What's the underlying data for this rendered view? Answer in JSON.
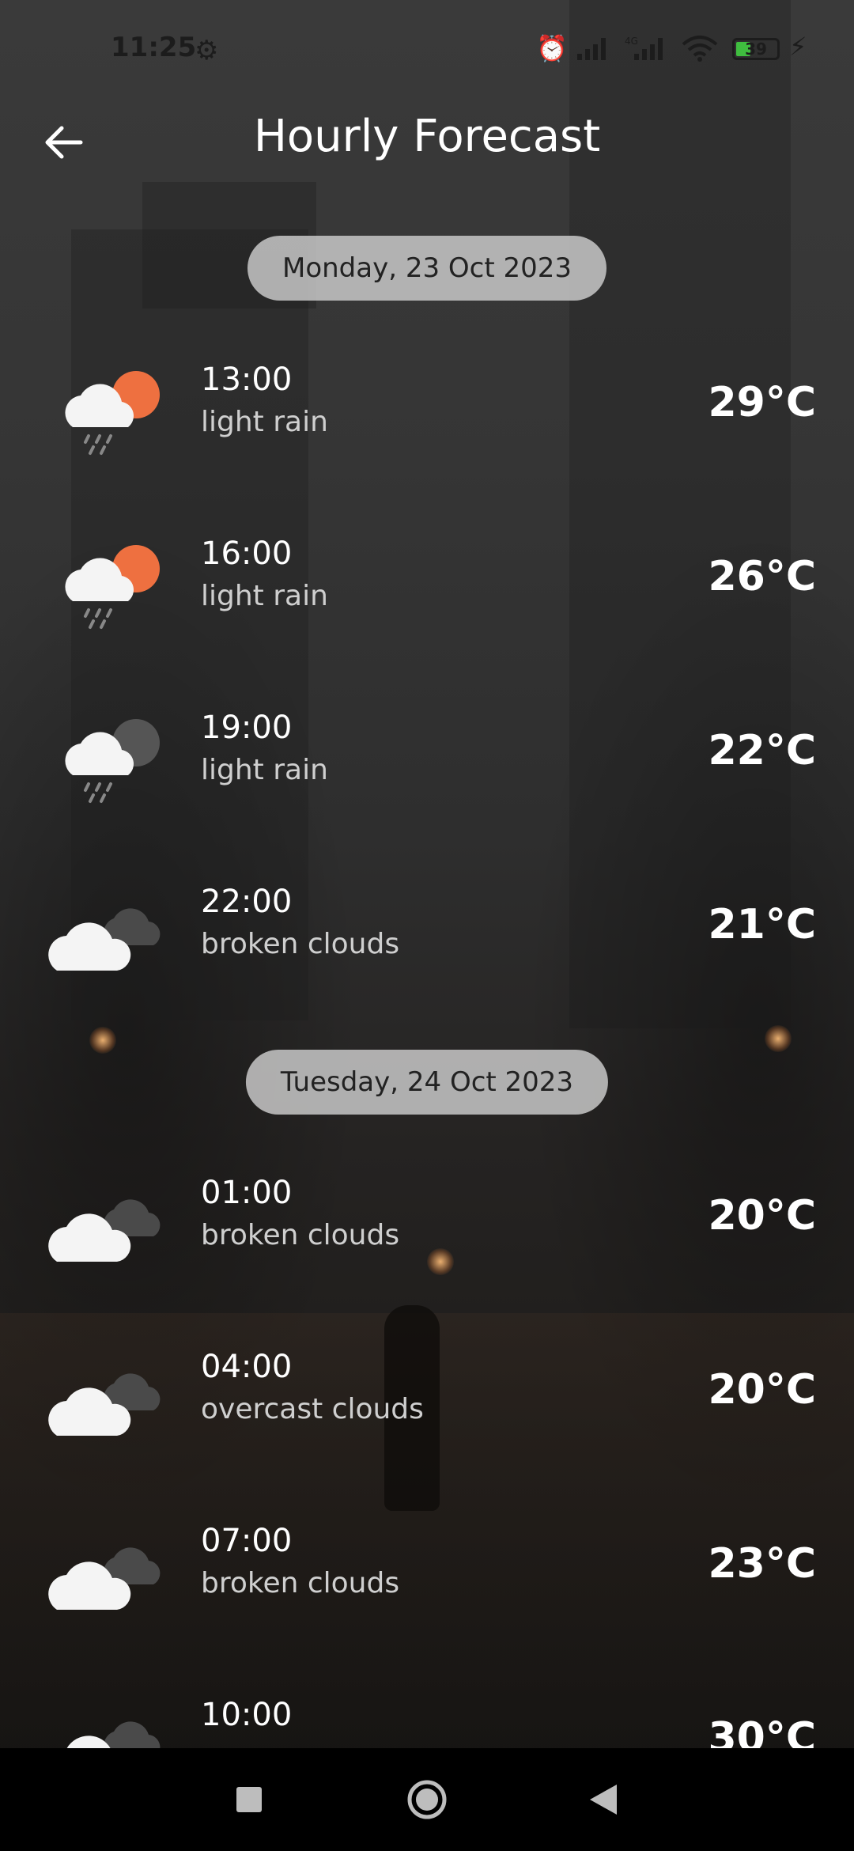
{
  "status_bar": {
    "time": "11:25",
    "battery_level": "39"
  },
  "header": {
    "title": "Hourly Forecast"
  },
  "days": [
    {
      "date_label": "Monday, 23 Oct 2023",
      "rows": [
        {
          "hour": "13:00",
          "description": "light rain",
          "temperature": "29°C",
          "icon": "rain-sun-icon"
        },
        {
          "hour": "16:00",
          "description": "light rain",
          "temperature": "26°C",
          "icon": "rain-sun-icon"
        },
        {
          "hour": "19:00",
          "description": "light rain",
          "temperature": "22°C",
          "icon": "rain-moon-icon"
        },
        {
          "hour": "22:00",
          "description": "broken clouds",
          "temperature": "21°C",
          "icon": "broken-clouds-icon"
        }
      ]
    },
    {
      "date_label": "Tuesday, 24 Oct 2023",
      "rows": [
        {
          "hour": "01:00",
          "description": "broken clouds",
          "temperature": "20°C",
          "icon": "broken-clouds-icon"
        },
        {
          "hour": "04:00",
          "description": "overcast clouds",
          "temperature": "20°C",
          "icon": "overcast-clouds-icon"
        },
        {
          "hour": "07:00",
          "description": "broken clouds",
          "temperature": "23°C",
          "icon": "broken-clouds-icon"
        },
        {
          "hour": "10:00",
          "description": "",
          "temperature": "30°C",
          "icon": "broken-clouds-icon"
        }
      ]
    }
  ],
  "colors": {
    "sun": "#ee7040",
    "moon": "#555555",
    "cloud": "#f4f4f4",
    "dark_cloud": "#4a4a4a",
    "pill_bg": "#c8c8c8"
  }
}
